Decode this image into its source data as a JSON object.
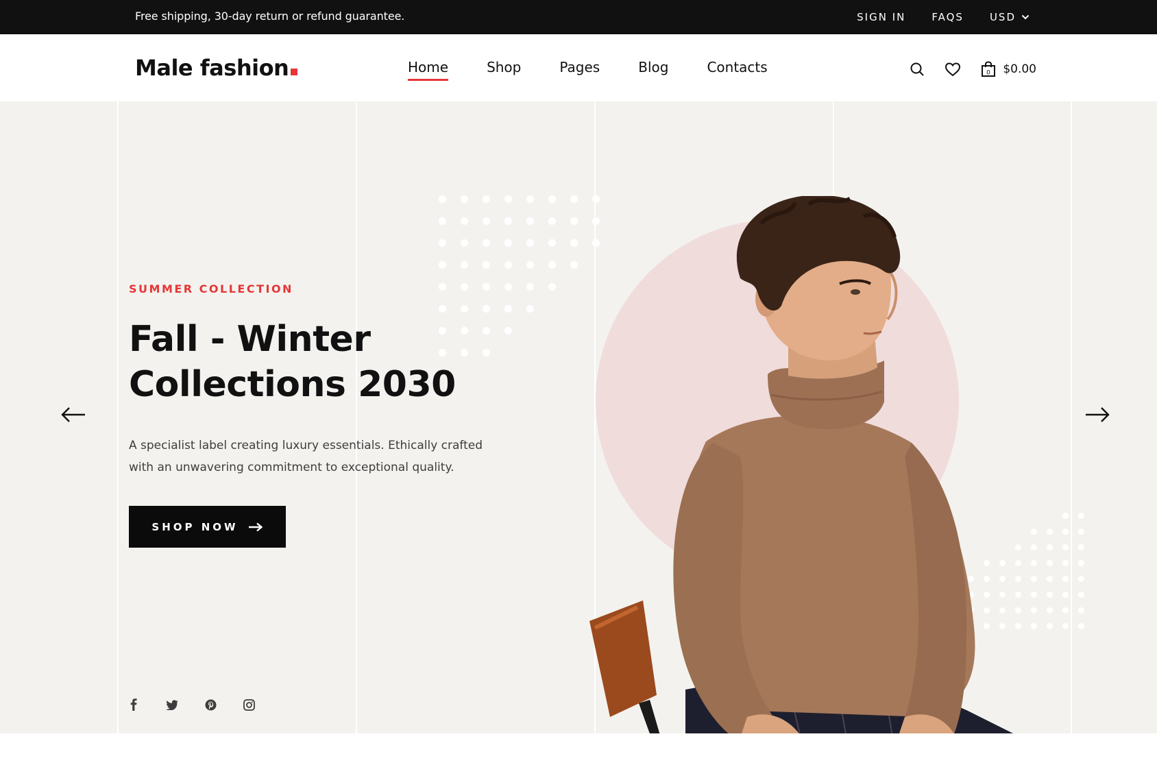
{
  "topbar": {
    "promo": "Free shipping, 30-day return or refund guarantee.",
    "sign_in": "SIGN IN",
    "faqs": "FAQS",
    "currency": "USD",
    "currency_icon": "chevron-down-icon"
  },
  "header": {
    "logo_text": "Male fashion",
    "nav": [
      {
        "label": "Home",
        "active": true
      },
      {
        "label": "Shop"
      },
      {
        "label": "Pages"
      },
      {
        "label": "Blog"
      },
      {
        "label": "Contacts"
      }
    ],
    "icons": [
      "search-icon",
      "heart-icon",
      "bag-icon"
    ],
    "cart_count": "0",
    "cart_total": "$0.00"
  },
  "hero": {
    "eyebrow": "SUMMER COLLECTION",
    "headline_line1": "Fall - Winter",
    "headline_line2": "Collections 2030",
    "description": "A specialist label creating luxury essentials. Ethically crafted with an unwavering commitment to exceptional quality.",
    "cta_label": "SHOP NOW",
    "cta_icon": "arrow-right-icon",
    "prev_icon": "arrow-left-icon",
    "next_icon": "arrow-right-icon",
    "social": [
      "facebook-icon",
      "twitter-icon",
      "pinterest-icon",
      "instagram-icon"
    ]
  },
  "colors": {
    "accent": "#e53637",
    "topbar_bg": "#111111",
    "hero_bg": "#f3f2ee",
    "circle": "#f1dcdc",
    "sweater": "#a6785a"
  }
}
